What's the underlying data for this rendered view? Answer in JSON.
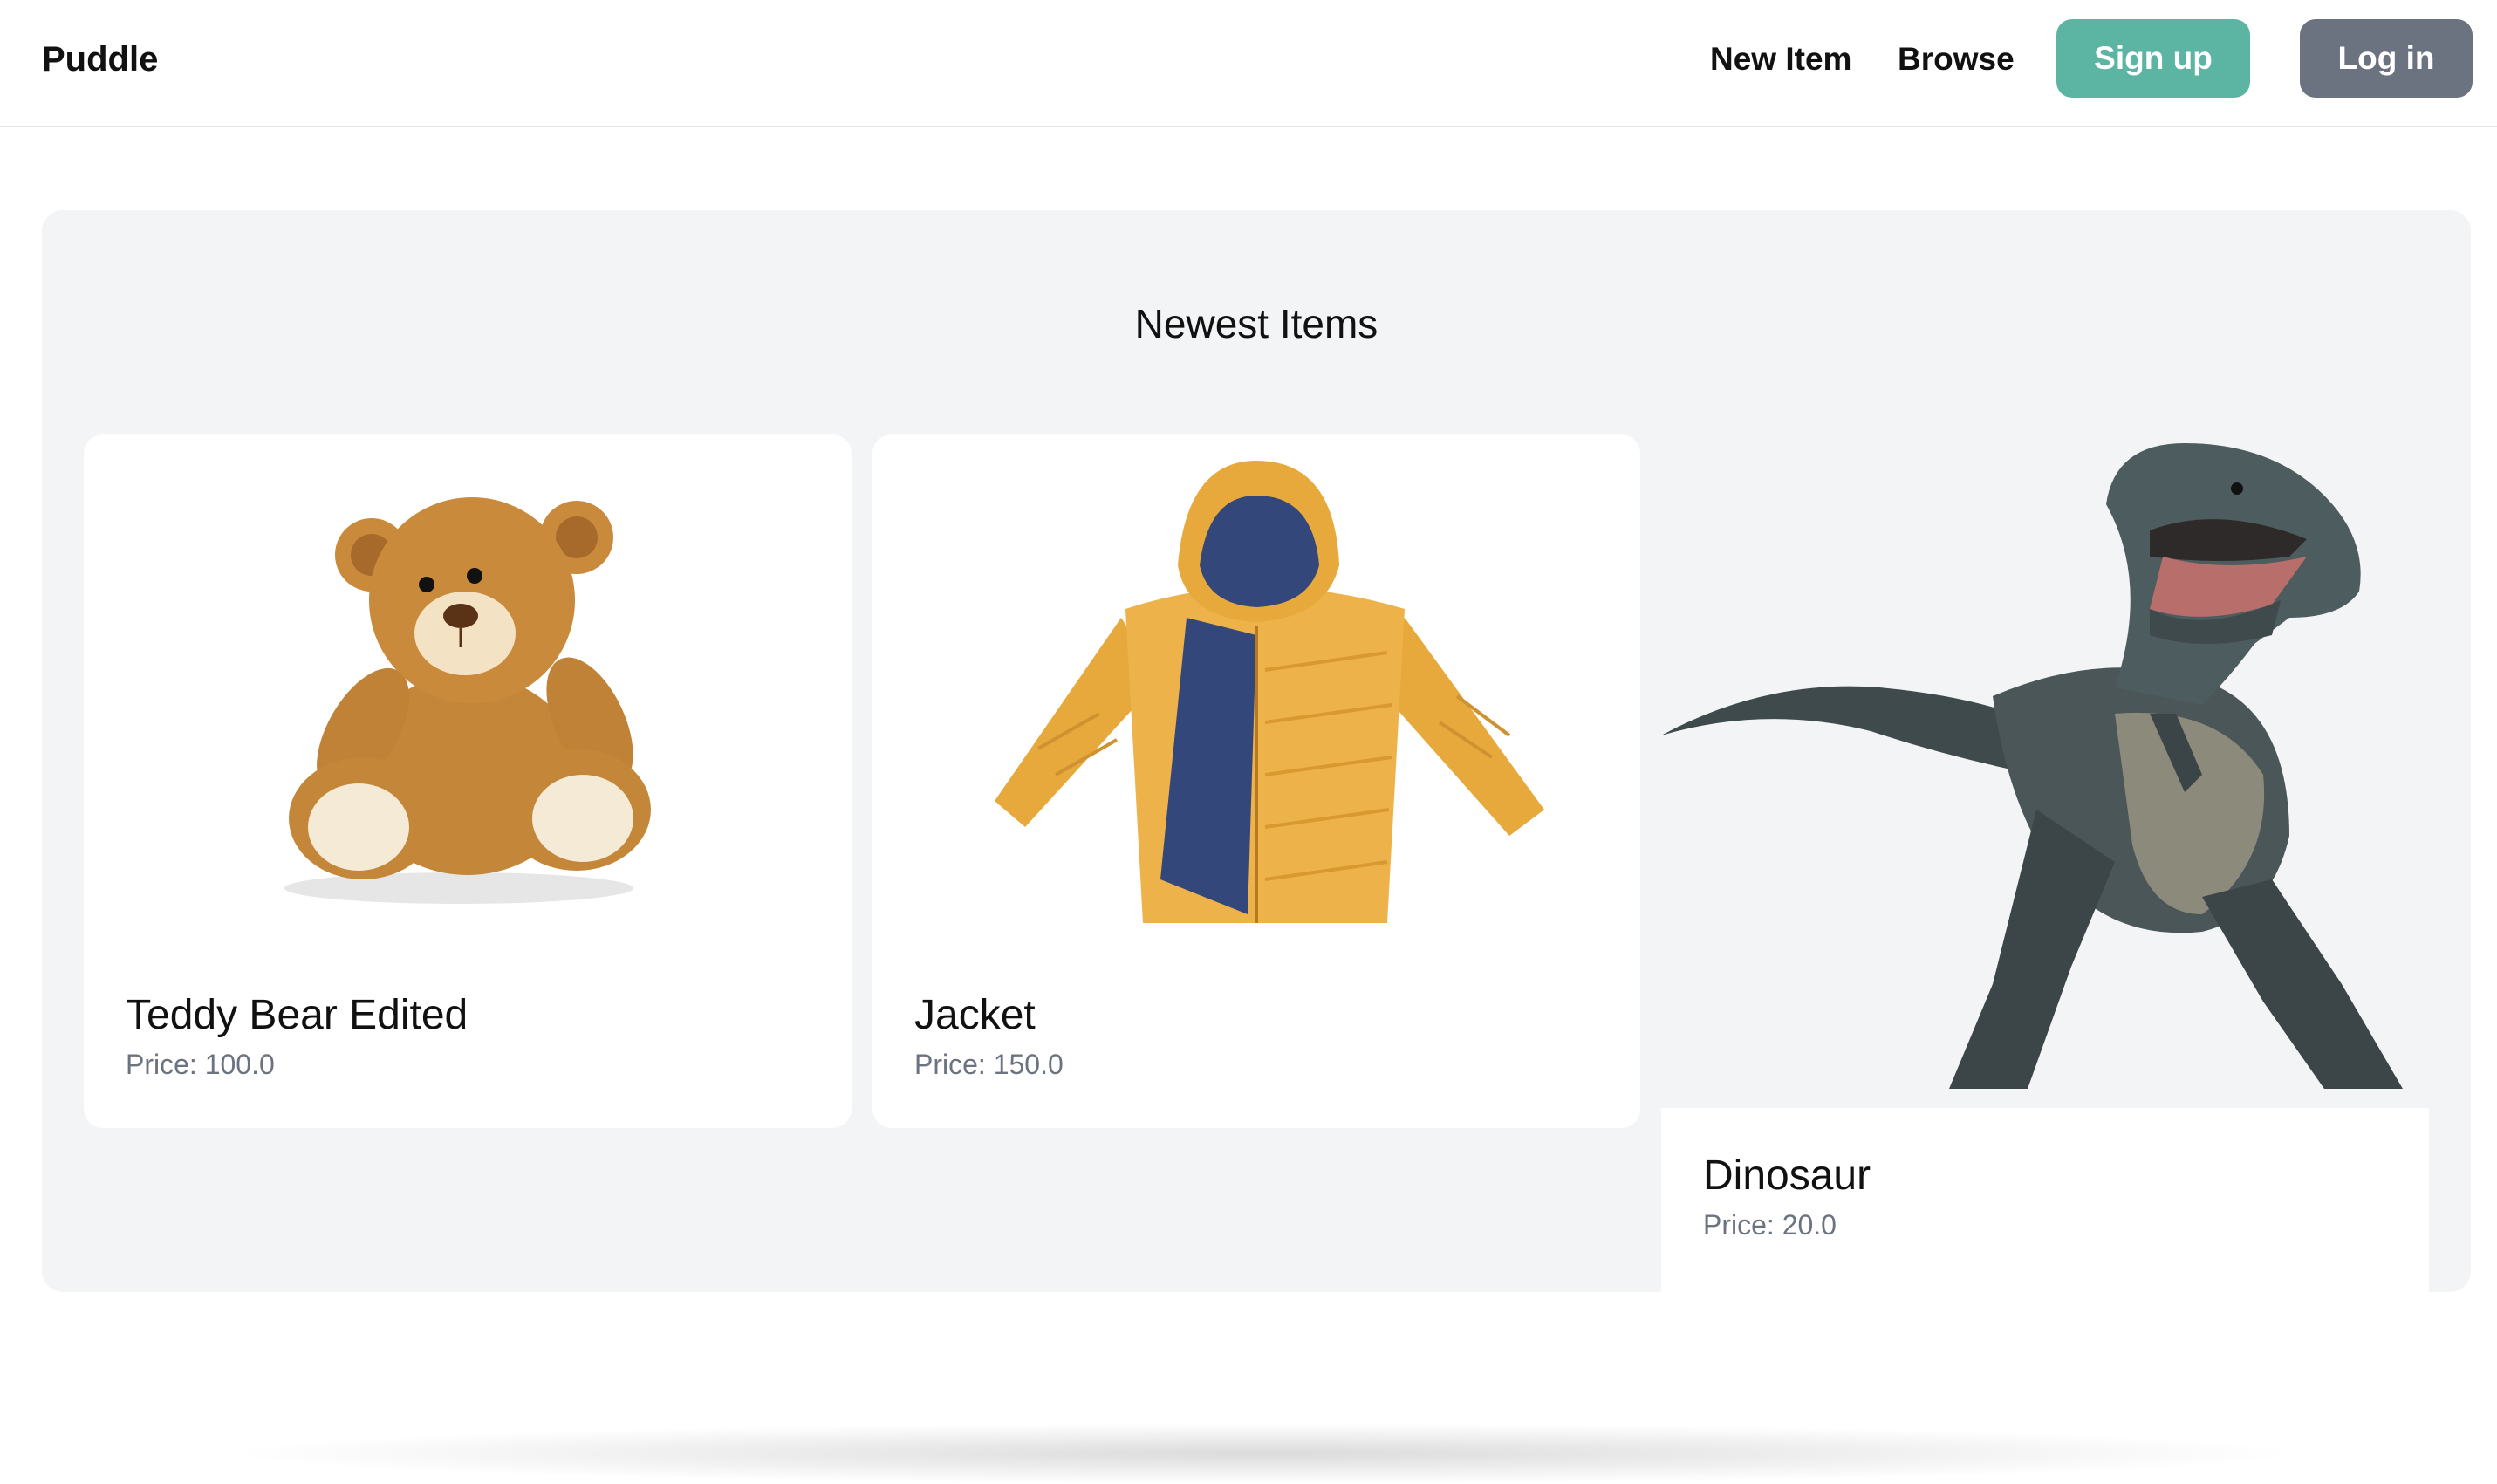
{
  "nav": {
    "brand": "Puddle",
    "links": [
      "New Item",
      "Browse"
    ],
    "signup_label": "Sign up",
    "login_label": "Log in"
  },
  "colors": {
    "signup": "#5bb5a2",
    "login": "#6b7280",
    "panel_bg": "#f3f4f6",
    "price_text": "#6b7280"
  },
  "newest": {
    "title": "Newest Items",
    "items": [
      {
        "name": "Teddy Bear Edited",
        "price": "Price: 100.0",
        "image": "teddy-bear"
      },
      {
        "name": "Jacket",
        "price": "Price: 150.0",
        "image": "yellow-puffer-jacket"
      },
      {
        "name": "Dinosaur",
        "price": "Price: 20.0",
        "image": "t-rex-dinosaur"
      }
    ]
  }
}
